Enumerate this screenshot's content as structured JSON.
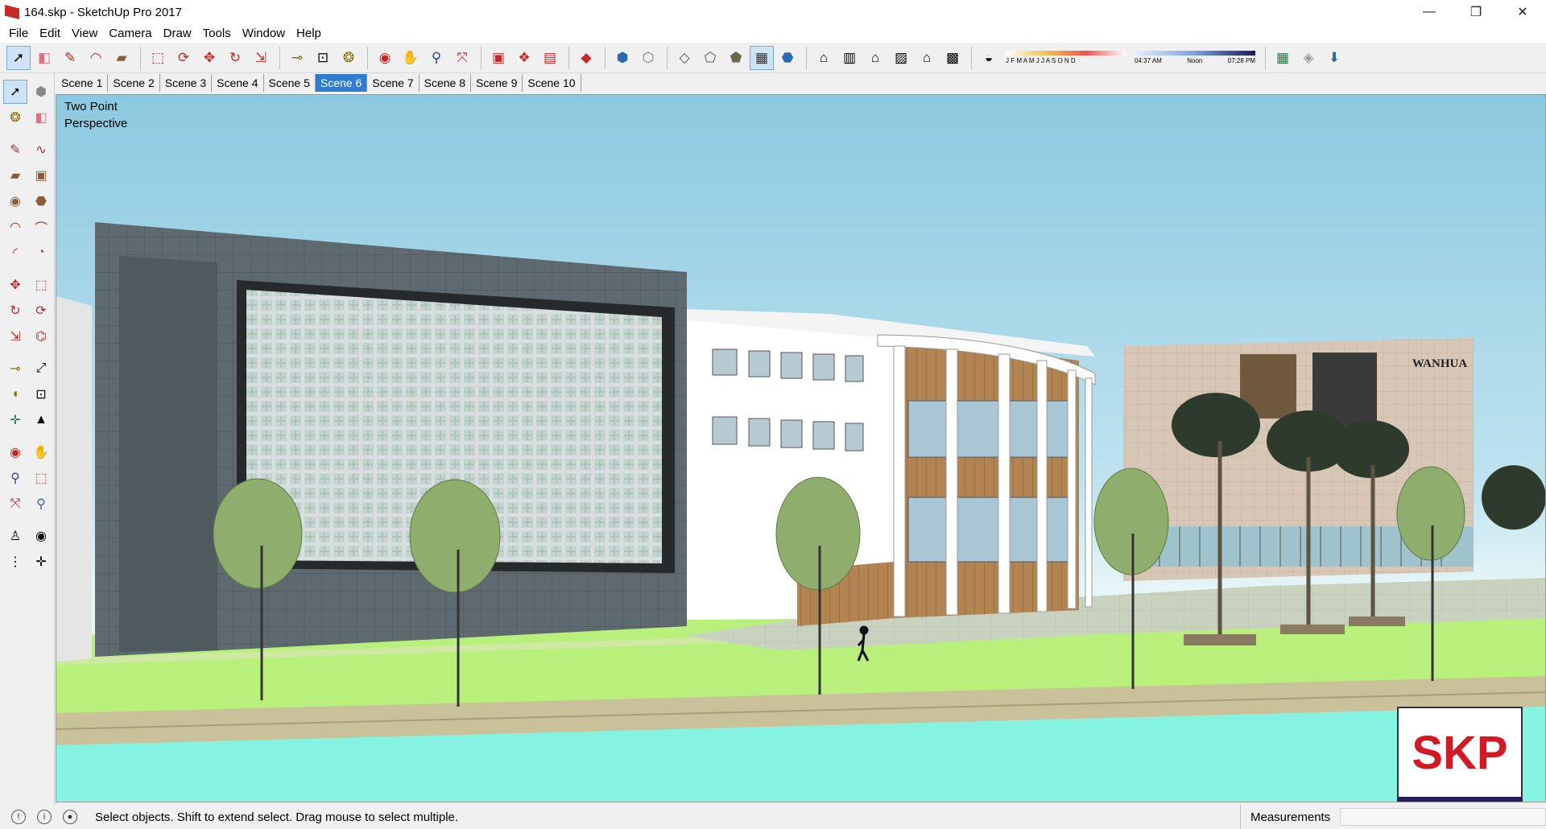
{
  "window": {
    "title": "164.skp - SketchUp Pro 2017",
    "minimize_glyph": "—",
    "restore_glyph": "❐",
    "close_glyph": "✕"
  },
  "menu": [
    "File",
    "Edit",
    "View",
    "Camera",
    "Draw",
    "Tools",
    "Window",
    "Help"
  ],
  "toolbar": {
    "groups": [
      [
        "select-icon",
        "eraser-icon",
        "pencil-icon",
        "arc-icon",
        "rectangle-icon"
      ],
      [
        "push-pull-icon",
        "follow-me-icon",
        "move-icon",
        "rotate-icon",
        "scale-icon"
      ],
      [
        "tape-measure-icon",
        "text-icon",
        "paint-bucket-icon"
      ],
      [
        "orbit-icon",
        "pan-icon",
        "zoom-icon",
        "zoom-extents-icon"
      ],
      [
        "3d-warehouse-icon",
        "extension-warehouse-icon",
        "send-to-layout-icon"
      ],
      [
        "ruby-icon"
      ],
      [
        "xray-icon",
        "back-edges-icon"
      ],
      [
        "wireframe-icon",
        "hidden-line-icon",
        "shaded-icon",
        "shaded-textures-icon",
        "monochrome-icon"
      ],
      [
        "iso-view-icon",
        "top-view-icon",
        "front-view-icon",
        "right-view-icon",
        "back-view-icon",
        "left-view-icon"
      ]
    ],
    "shadow_months": "J F M A M J J A S O N D",
    "time_start": "04:37 AM",
    "time_noon": "Noon",
    "time_end": "07:28 PM"
  },
  "scenes": [
    "Scene 1",
    "Scene 2",
    "Scene 3",
    "Scene 4",
    "Scene 5",
    "Scene 6",
    "Scene 7",
    "Scene 8",
    "Scene 9",
    "Scene 10"
  ],
  "active_scene": "Scene 6",
  "viewport": {
    "camera_label": "Two Point Perspective",
    "building_sign": "WANHUA",
    "logo_text": "SKP"
  },
  "status": {
    "message": "Select objects. Shift to extend select. Drag mouse to select multiple.",
    "measurements_label": "Measurements",
    "measurements_value": ""
  },
  "colors": {
    "sky_top": "#8cc9e0",
    "grass": "#b9f07c",
    "water": "#86f2e2",
    "active_tab": "#2f7dd0",
    "logo_red": "#d11a24"
  }
}
